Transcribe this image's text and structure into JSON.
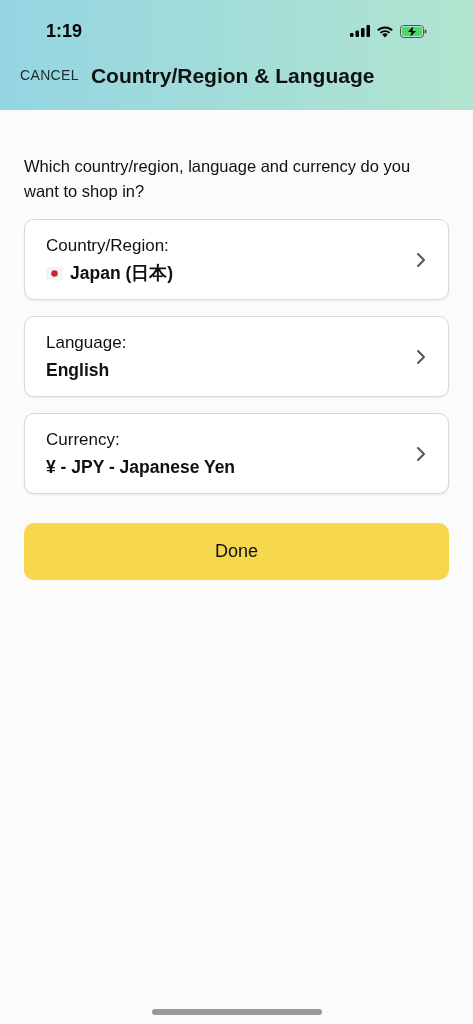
{
  "status_bar": {
    "time": "1:19"
  },
  "header": {
    "cancel": "CANCEL",
    "title": "Country/Region & Language"
  },
  "question": "Which country/region, language and currency do you want to shop in?",
  "options": [
    {
      "kind": "flag",
      "label": "Country/Region:",
      "value": "Japan (日本)"
    },
    {
      "kind": "plain",
      "label": "Language:",
      "value": "English"
    },
    {
      "kind": "plain",
      "label": "Currency:",
      "value": "¥ - JPY - Japanese Yen"
    }
  ],
  "done_button": "Done"
}
